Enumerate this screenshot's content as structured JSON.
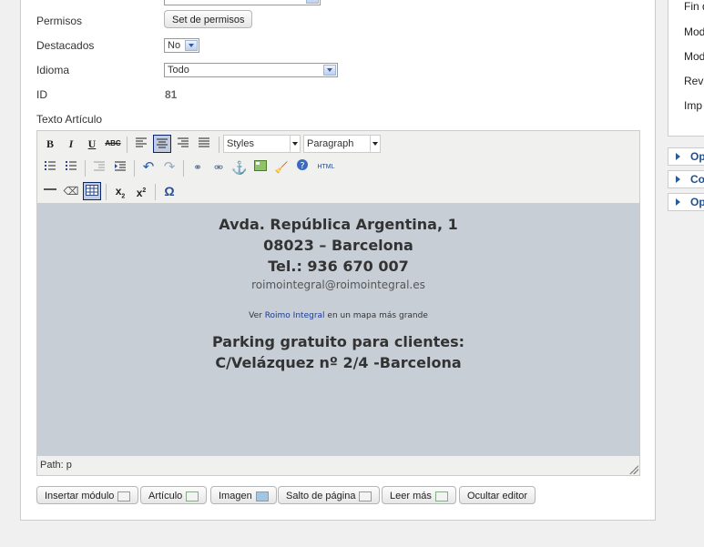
{
  "form": {
    "permisos_label": "Permisos",
    "permisos_button": "Set de permisos",
    "destacados_label": "Destacados",
    "destacados_value": "No",
    "idioma_label": "Idioma",
    "idioma_value": "Todo",
    "id_label": "ID",
    "id_value": "81",
    "texto_label": "Texto Artículo"
  },
  "toolbar": {
    "styles": "Styles",
    "format": "Paragraph",
    "html_label": "HTML"
  },
  "content": {
    "line1": "Avda. República Argentina, 1",
    "line2": "08023 – Barcelona",
    "line3": "Tel.: 936 670 007",
    "email": "roimointegral@roimointegral.es",
    "map_prefix": "Ver",
    "map_link": "Roimo Integral",
    "map_suffix": "en un mapa más grande",
    "parking1": "Parking gratuito para clientes:",
    "parking2": "C/Velázquez nº 2/4 -Barcelona"
  },
  "editor": {
    "path": "Path: p"
  },
  "bottom_buttons": {
    "insertar": "Insertar módulo",
    "articulo": "Artículo",
    "imagen": "Imagen",
    "salto": "Salto de página",
    "leer": "Leer más",
    "ocultar": "Ocultar editor"
  },
  "right_sidebar": {
    "item1": "Fin d",
    "item2": "Mod",
    "item3": "Mod",
    "item4": "Rev",
    "item5": "Imp",
    "panel1": "Op",
    "panel2": "Co",
    "panel3": "Op"
  }
}
